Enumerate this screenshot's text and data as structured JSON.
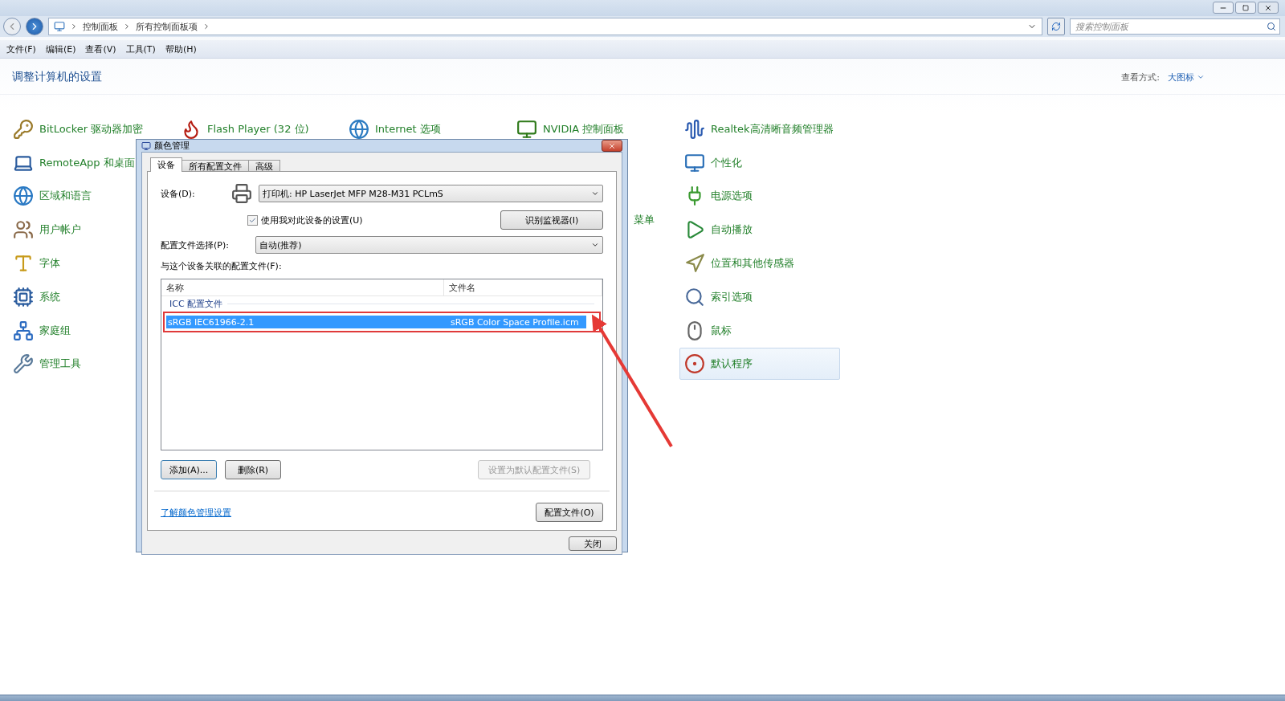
{
  "address_bar": {
    "breadcrumbs": [
      "控制面板",
      "所有控制面板项"
    ],
    "search": {
      "placeholder": "搜索控制面板"
    }
  },
  "menu": [
    "文件(F)",
    "编辑(E)",
    "查看(V)",
    "工具(T)",
    "帮助(H)"
  ],
  "header": {
    "title": "调整计算机的设置",
    "view_label": "查看方式:",
    "view_value": "大图标"
  },
  "icon_columns": [
    {
      "items": [
        {
          "label": "BitLocker 驱动器加密"
        },
        {
          "label": "RemoteApp 和桌面"
        },
        {
          "label": "区域和语言"
        },
        {
          "label": "用户帐户"
        },
        {
          "label": "字体"
        },
        {
          "label": "系统"
        },
        {
          "label": "家庭组"
        },
        {
          "label": "管理工具"
        }
      ]
    },
    {
      "items": [
        {
          "label": "Flash Player (32 位)"
        }
      ]
    },
    {
      "items": [
        {
          "label": "Internet 选项"
        }
      ]
    },
    {
      "items": [
        {
          "label": "NVIDIA 控制面板"
        },
        {
          "label": "菜单",
          "kind": "partial"
        }
      ]
    },
    {
      "items": [
        {
          "label": "Realtek高清晰音频管理器",
          "selected": false
        },
        {
          "label": "个性化",
          "selected": false
        },
        {
          "label": "电源选项",
          "selected": false
        },
        {
          "label": "自动播放",
          "selected": false
        },
        {
          "label": "位置和其他传感器",
          "selected": false
        },
        {
          "label": "索引选项",
          "selected": false
        },
        {
          "label": "鼠标",
          "selected": false
        },
        {
          "label": "默认程序",
          "selected": true
        }
      ]
    }
  ],
  "dialog": {
    "title": "颜色管理",
    "tabs": [
      {
        "label": "设备",
        "selected": true
      },
      {
        "label": "所有配置文件",
        "selected": false
      },
      {
        "label": "高级",
        "selected": false
      }
    ],
    "device_label": "设备(D):",
    "device_value": "打印机: HP LaserJet MFP M28-M31 PCLmS",
    "use_settings": {
      "label": "使用我对此设备的设置(U)",
      "checked": true
    },
    "identify_button": "识别监视器(I)",
    "profile_select_label": "配置文件选择(P):",
    "profile_select_value": "自动(推荐)",
    "associated_label": "与这个设备关联的配置文件(F):",
    "columns": [
      "名称",
      "文件名"
    ],
    "group": "ICC 配置文件",
    "rows": [
      {
        "name": "sRGB IEC61966-2.1",
        "file": "sRGB Color Space Profile.icm",
        "selected": true
      }
    ],
    "buttons": [
      {
        "label": "添加(A)...",
        "disabled": false
      },
      {
        "label": "删除(R)",
        "disabled": false
      },
      {
        "label": "设置为默认配置文件(S)",
        "disabled": true
      }
    ],
    "link": "了解颜色管理设置",
    "profiles_button": "配置文件(O)",
    "close_button": "关闭"
  }
}
